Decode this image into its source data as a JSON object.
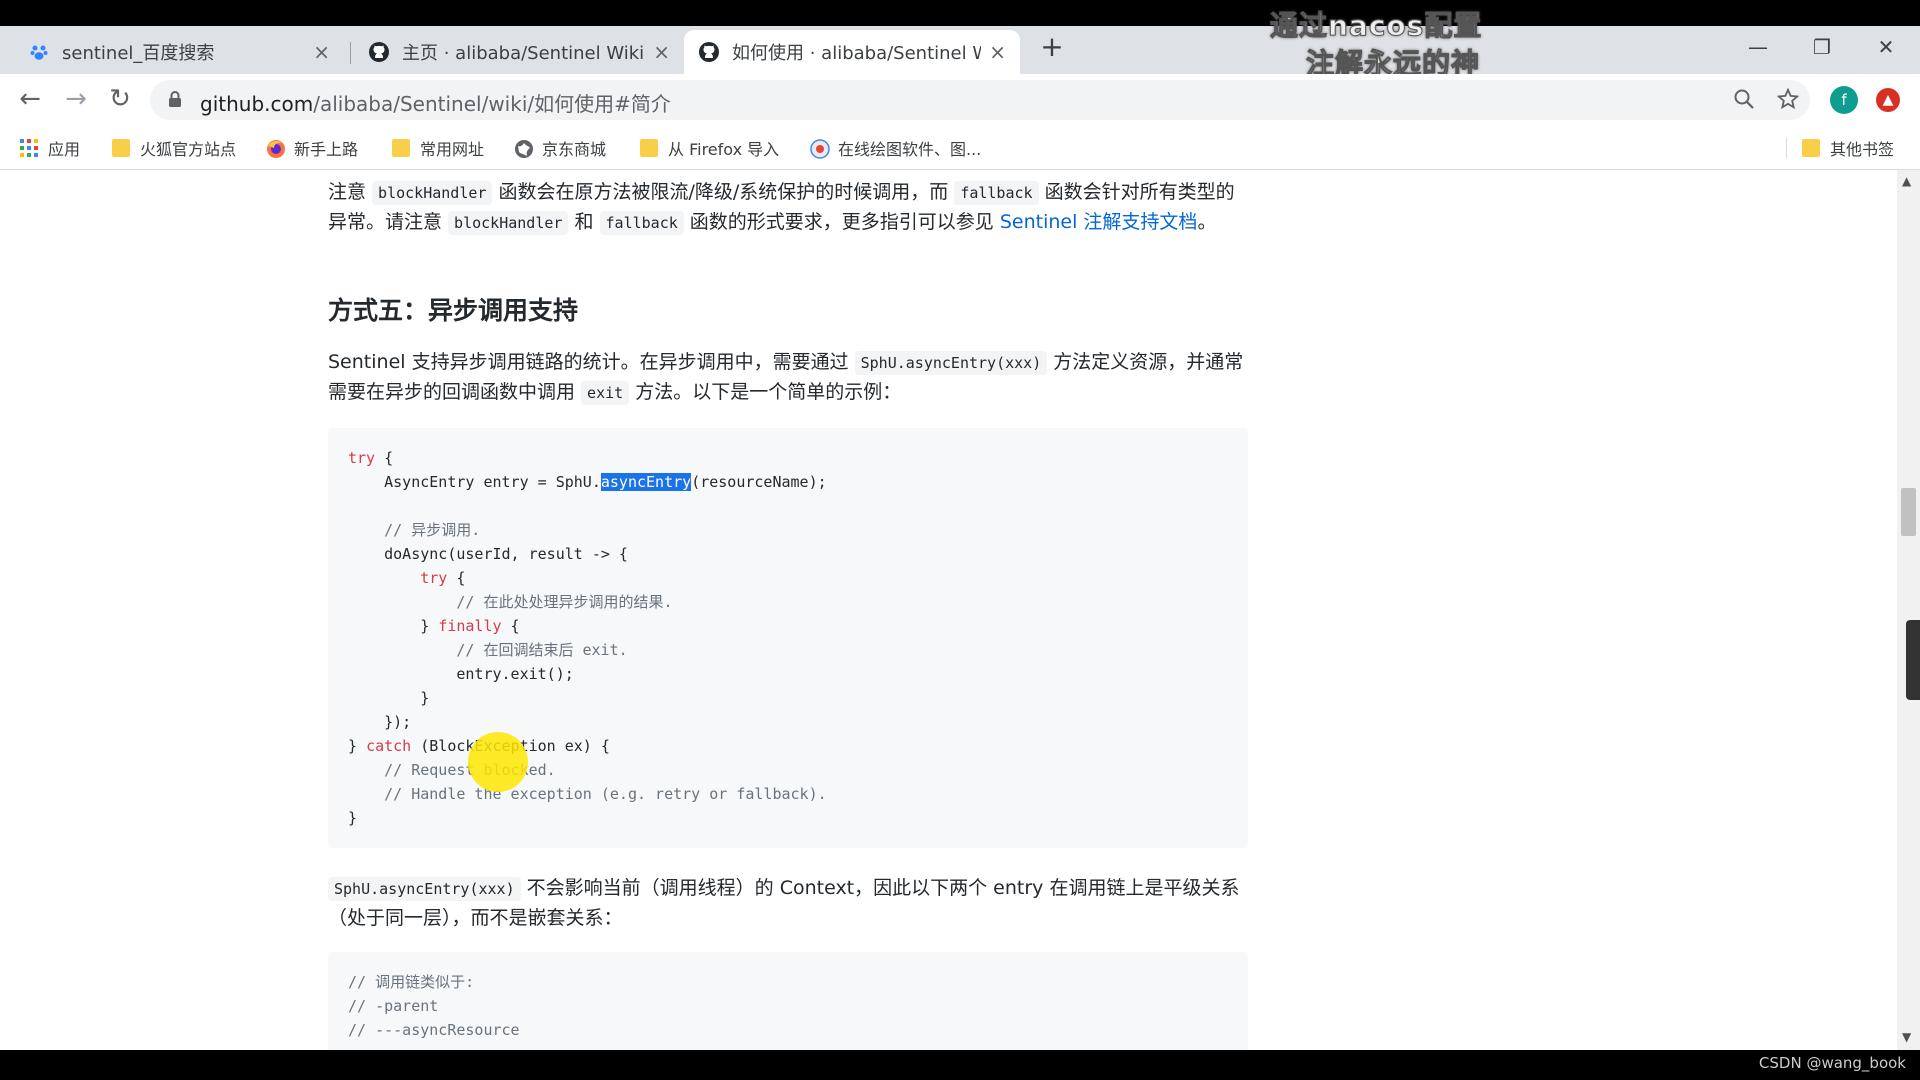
{
  "tabs": [
    {
      "title": "sentinel_百度搜索",
      "close": "×"
    },
    {
      "title": "主页 · alibaba/Sentinel Wiki · G",
      "close": "×"
    },
    {
      "title": "如何使用 · alibaba/Sentinel Wi",
      "close": "×"
    }
  ],
  "newtab": "+",
  "window": {
    "minimize": "—",
    "restore": "❐",
    "close": "✕"
  },
  "overlay": {
    "line1": "通过nacos配置",
    "line2": "注解永远的神"
  },
  "nav": {
    "back": "←",
    "forward": "→",
    "reload": "↻"
  },
  "url": {
    "host": "github.com",
    "path": "/alibaba/Sentinel/wiki/如何使用#简介"
  },
  "profile_initial": "f",
  "bookmarks": [
    {
      "label": "应用"
    },
    {
      "label": "火狐官方站点"
    },
    {
      "label": "新手上路"
    },
    {
      "label": "常用网址"
    },
    {
      "label": "京东商城"
    },
    {
      "label": "从 Firefox 导入"
    },
    {
      "label": "在线绘图软件、图..."
    }
  ],
  "other_bookmarks": "其他书签",
  "content": {
    "p1": {
      "t1": "注意 ",
      "c1": "blockHandler",
      "t2": " 函数会在原方法被限流/降级/系统保护的时候调用，而 ",
      "c2": "fallback",
      "t3": " 函数会针对所有类型的异常。请注意 ",
      "c3": "blockHandler",
      "t4": " 和 ",
      "c4": "fallback",
      "t5": " 函数的形式要求，更多指引可以参见 ",
      "link": "Sentinel 注解支持文档",
      "t6": "。"
    },
    "h3": "方式五：异步调用支持",
    "p2": {
      "t1": "Sentinel 支持异步调用链路的统计。在异步调用中，需要通过 ",
      "c1": "SphU.asyncEntry(xxx)",
      "t2": " 方法定义资源，并通常需要在异步的回调函数中调用 ",
      "c2": "exit",
      "t3": " 方法。以下是一个简单的示例："
    },
    "code1": {
      "l1_kw": "try",
      "l1_rest": " {",
      "l2_pre": "    AsyncEntry entry = SphU.",
      "l2_sel": "asyncEntry",
      "l2_post": "(resourceName);",
      "l4": "    // 异步调用.",
      "l5": "    doAsync(userId, result -> {",
      "l6_pre": "        ",
      "l6_kw": "try",
      "l6_rest": " {",
      "l7": "            // 在此处处理异步调用的结果.",
      "l8_pre": "        } ",
      "l8_kw": "finally",
      "l8_rest": " {",
      "l9": "            // 在回调结束后 exit.",
      "l10": "            entry.exit();",
      "l11": "        }",
      "l12": "    });",
      "l13_pre": "} ",
      "l13_kw": "catch",
      "l13_rest": " (BlockException ex) {",
      "l14": "    // Request blocked.",
      "l15": "    // Handle the exception (e.g. retry or fallback).",
      "l16": "}"
    },
    "p3": {
      "c1": "SphU.asyncEntry(xxx)",
      "t1": " 不会影响当前（调用线程）的 Context，因此以下两个 entry 在调用链上是平级关系（处于同一层），而不是嵌套关系："
    },
    "code2": {
      "l1": "// 调用链类似于:",
      "l2": "// -parent",
      "l3": "// ---asyncResource"
    }
  },
  "watermark": "CSDN @wang_book"
}
